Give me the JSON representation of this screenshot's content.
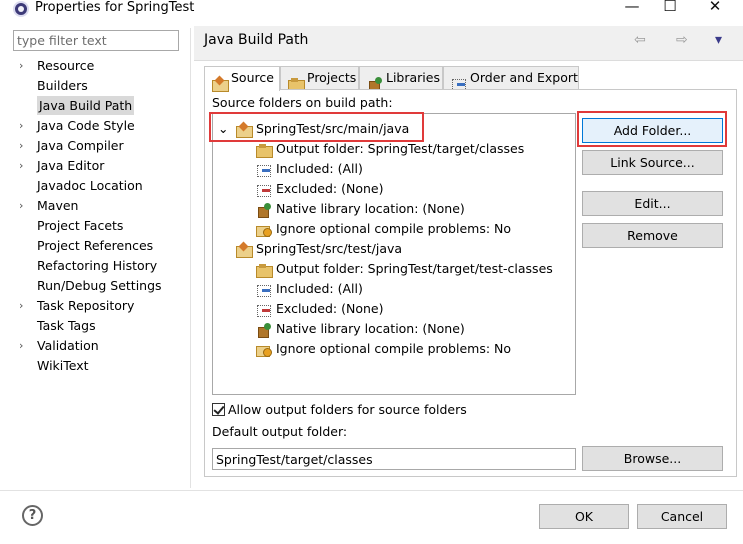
{
  "window": {
    "title": "Properties for SpringTest",
    "minimize": "—",
    "maximize": "☐",
    "close": "✕"
  },
  "filter": {
    "placeholder": "type filter text"
  },
  "nav": {
    "items": [
      {
        "label": "Resource",
        "expandable": true
      },
      {
        "label": "Builders",
        "expandable": false
      },
      {
        "label": "Java Build Path",
        "expandable": false,
        "selected": true
      },
      {
        "label": "Java Code Style",
        "expandable": true
      },
      {
        "label": "Java Compiler",
        "expandable": true
      },
      {
        "label": "Java Editor",
        "expandable": true
      },
      {
        "label": "Javadoc Location",
        "expandable": false
      },
      {
        "label": "Maven",
        "expandable": true
      },
      {
        "label": "Project Facets",
        "expandable": false
      },
      {
        "label": "Project References",
        "expandable": false
      },
      {
        "label": "Refactoring History",
        "expandable": false
      },
      {
        "label": "Run/Debug Settings",
        "expandable": false
      },
      {
        "label": "Task Repository",
        "expandable": true
      },
      {
        "label": "Task Tags",
        "expandable": false
      },
      {
        "label": "Validation",
        "expandable": true
      },
      {
        "label": "WikiText",
        "expandable": false
      }
    ]
  },
  "page": {
    "title": "Java Build Path",
    "back": "⇦",
    "forward": "⇨",
    "menu": "▾"
  },
  "tabs": [
    {
      "label": "Source",
      "active": true
    },
    {
      "label": "Projects"
    },
    {
      "label": "Libraries"
    },
    {
      "label": "Order and Export"
    }
  ],
  "source": {
    "heading": "Source folders on build path:",
    "folders": [
      {
        "name": "SpringTest/src/main/java",
        "children": [
          "Output folder: SpringTest/target/classes",
          "Included: (All)",
          "Excluded: (None)",
          "Native library location: (None)",
          "Ignore optional compile problems: No"
        ]
      },
      {
        "name": "SpringTest/src/test/java",
        "children": [
          "Output folder: SpringTest/target/test-classes",
          "Included: (All)",
          "Excluded: (None)",
          "Native library location: (None)",
          "Ignore optional compile problems: No"
        ]
      }
    ],
    "buttons": {
      "add_folder": "Add Folder...",
      "link_source": "Link Source...",
      "edit": "Edit...",
      "remove": "Remove"
    },
    "allow_output_label": "Allow output folders for source folders",
    "allow_output_checked": true,
    "default_output_label": "Default output folder:",
    "default_output_value": "SpringTest/target/classes",
    "browse": "Browse..."
  },
  "footer": {
    "help": "?",
    "ok": "OK",
    "cancel": "Cancel"
  },
  "colors": {
    "highlight": "#e03a3a",
    "default_button_border": "#0078d7"
  }
}
